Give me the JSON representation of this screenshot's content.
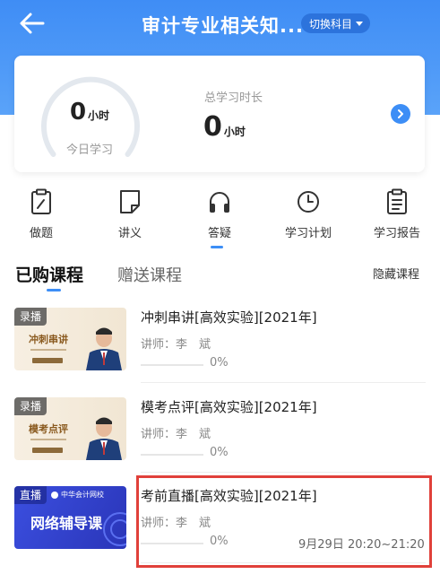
{
  "header": {
    "title": "审计专业相关知...",
    "switch_label": "切换科目",
    "bg_color": "#4b97f7"
  },
  "summary": {
    "today_value": "0",
    "today_unit": "小时",
    "today_label": "今日学习",
    "today_progress": 0,
    "total_label": "总学习时长",
    "total_value": "0",
    "total_unit": "小时"
  },
  "nav": [
    {
      "label": "做题",
      "icon": "clipboard-icon"
    },
    {
      "label": "讲义",
      "icon": "note-icon"
    },
    {
      "label": "答疑",
      "icon": "headphones-icon",
      "active": true
    },
    {
      "label": "学习计划",
      "icon": "clock-icon"
    },
    {
      "label": "学习报告",
      "icon": "report-icon"
    }
  ],
  "tabs": {
    "bought": "已购课程",
    "gift": "赠送课程",
    "hide": "隐藏课程"
  },
  "courses": [
    {
      "badge": "录播",
      "thumb_text": "冲刺串讲",
      "title": "冲刺串讲[高效实验][2021年]",
      "teacher": "讲师：李　斌",
      "progress": "0%",
      "time": ""
    },
    {
      "badge": "录播",
      "thumb_text": "模考点评",
      "title": "模考点评[高效实验][2021年]",
      "teacher": "讲师：李　斌",
      "progress": "0%",
      "time": ""
    },
    {
      "badge": "直播",
      "thumb_brand": "中华会计网校",
      "thumb_text": "网络辅导课",
      "title": "考前直播[高效实验][2021年]",
      "teacher": "讲师：李　斌",
      "progress": "0%",
      "time": "9月29日 20:20~21:20"
    }
  ],
  "colors": {
    "accent": "#3d8ef6",
    "highlight": "#e0403a"
  }
}
